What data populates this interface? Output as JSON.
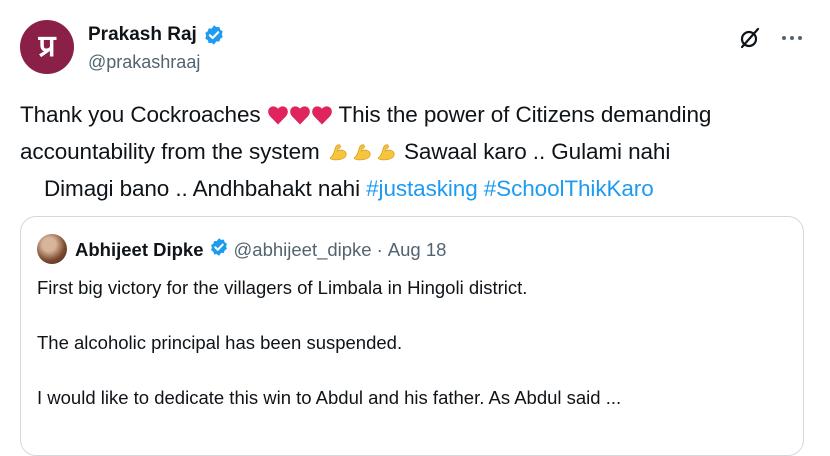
{
  "author": {
    "avatar_letter": "प्र",
    "name": "Prakash Raj",
    "handle": "@prakashraaj"
  },
  "tweet": {
    "line1_pre": "Thank you Cockroaches",
    "line1_post": "This the power of Citizens demanding",
    "line2_pre": "accountability from the system",
    "line2_post": "Sawaal karo .. Gulami nahi",
    "line3_text": "Dimagi bano .. Andhbahakt nahi",
    "hashtag1": "#justasking",
    "hashtag2": "#SchoolThikKaro",
    "emoji_hearts": [
      "red-heart",
      "red-heart",
      "red-heart"
    ],
    "emoji_arms": [
      "flexed-biceps",
      "flexed-biceps",
      "flexed-biceps"
    ]
  },
  "quoted": {
    "name": "Abhijeet Dipke",
    "handle": "@abhijeet_dipke",
    "separator": "·",
    "date": "Aug 18",
    "paragraphs": [
      "First big victory for the villagers of Limbala in Hingoli district.",
      "The alcoholic principal has been suspended.",
      "I would like to dedicate this win to Abdul and his father. As Abdul said ..."
    ]
  },
  "colors": {
    "link": "#1d9bf0",
    "verified": "#1d9bf0",
    "heart": "#e0245e",
    "arm": "#f5c540",
    "border": "#cfd9de",
    "avatar_bg": "#8a1f47"
  },
  "icons": [
    "verified-badge-icon",
    "grok-icon",
    "more-options-icon",
    "red-heart-icon",
    "flexed-biceps-icon"
  ]
}
